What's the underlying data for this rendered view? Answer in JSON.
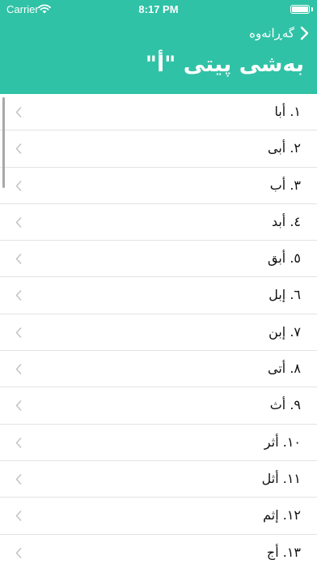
{
  "status_bar": {
    "carrier": "Carrier",
    "time": "8:17 PM"
  },
  "nav": {
    "back_label": "گەڕانەوە",
    "title": "بەشی پیتی \"أ\""
  },
  "colors": {
    "header": "#30c2a6",
    "separator": "#e3e3e6",
    "chevron": "#c4c4c8"
  },
  "icons": {
    "back": "chevron-right-icon",
    "row": "chevron-left-icon",
    "signal": "wifi-icon",
    "power": "battery-icon"
  },
  "items": [
    {
      "label": "١. أبا"
    },
    {
      "label": "٢. أبى"
    },
    {
      "label": "٣. أب"
    },
    {
      "label": "٤. أبد"
    },
    {
      "label": "٥. أبق"
    },
    {
      "label": "٦. إبل"
    },
    {
      "label": "٧. إبن"
    },
    {
      "label": "٨. أتى"
    },
    {
      "label": "٩. أث"
    },
    {
      "label": "١٠. أثر"
    },
    {
      "label": "١١. أثل"
    },
    {
      "label": "١٢. إثم"
    },
    {
      "label": "١٣. أج"
    }
  ]
}
